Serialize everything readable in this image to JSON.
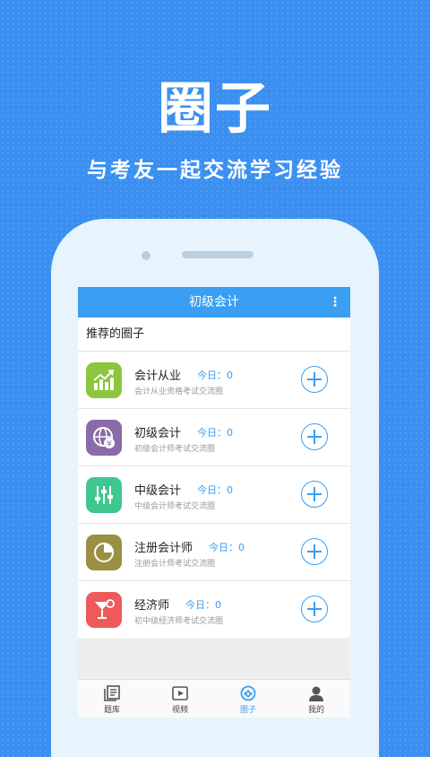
{
  "hero": {
    "title": "圈子",
    "subtitle": "与考友一起交流学习经验"
  },
  "appbar": {
    "title": "初级会计",
    "menu": "⋮"
  },
  "section": {
    "title": "推荐的圈子"
  },
  "circles": [
    {
      "name": "会计从业",
      "today": "今日：0",
      "desc": "会计从业资格考试交流圈",
      "icon": "chart-up-icon",
      "color": "#8cc63f"
    },
    {
      "name": "初级会计",
      "today": "今日：0",
      "desc": "初级会计师考试交流圈",
      "icon": "globe-yen-icon",
      "color": "#8a6aa8"
    },
    {
      "name": "中级会计",
      "today": "今日：0",
      "desc": "中级会计师考试交流圈",
      "icon": "sliders-icon",
      "color": "#3ec78f"
    },
    {
      "name": "注册会计师",
      "today": "今日：0",
      "desc": "注册会计师考试交流圈",
      "icon": "pie-chart-icon",
      "color": "#9a9043"
    },
    {
      "name": "经济师",
      "today": "今日：0",
      "desc": "初中级经济师考试交流圈",
      "icon": "cocktail-icon",
      "color": "#ee5a5a"
    }
  ],
  "tabs": [
    {
      "label": "题库",
      "icon": "question-bank-icon",
      "active": false
    },
    {
      "label": "视频",
      "icon": "video-icon",
      "active": false
    },
    {
      "label": "圈子",
      "icon": "circle-icon",
      "active": true
    },
    {
      "label": "我的",
      "icon": "user-icon",
      "active": false
    }
  ],
  "colors": {
    "background": "#3a8ff0",
    "accent": "#3a9ef2"
  }
}
